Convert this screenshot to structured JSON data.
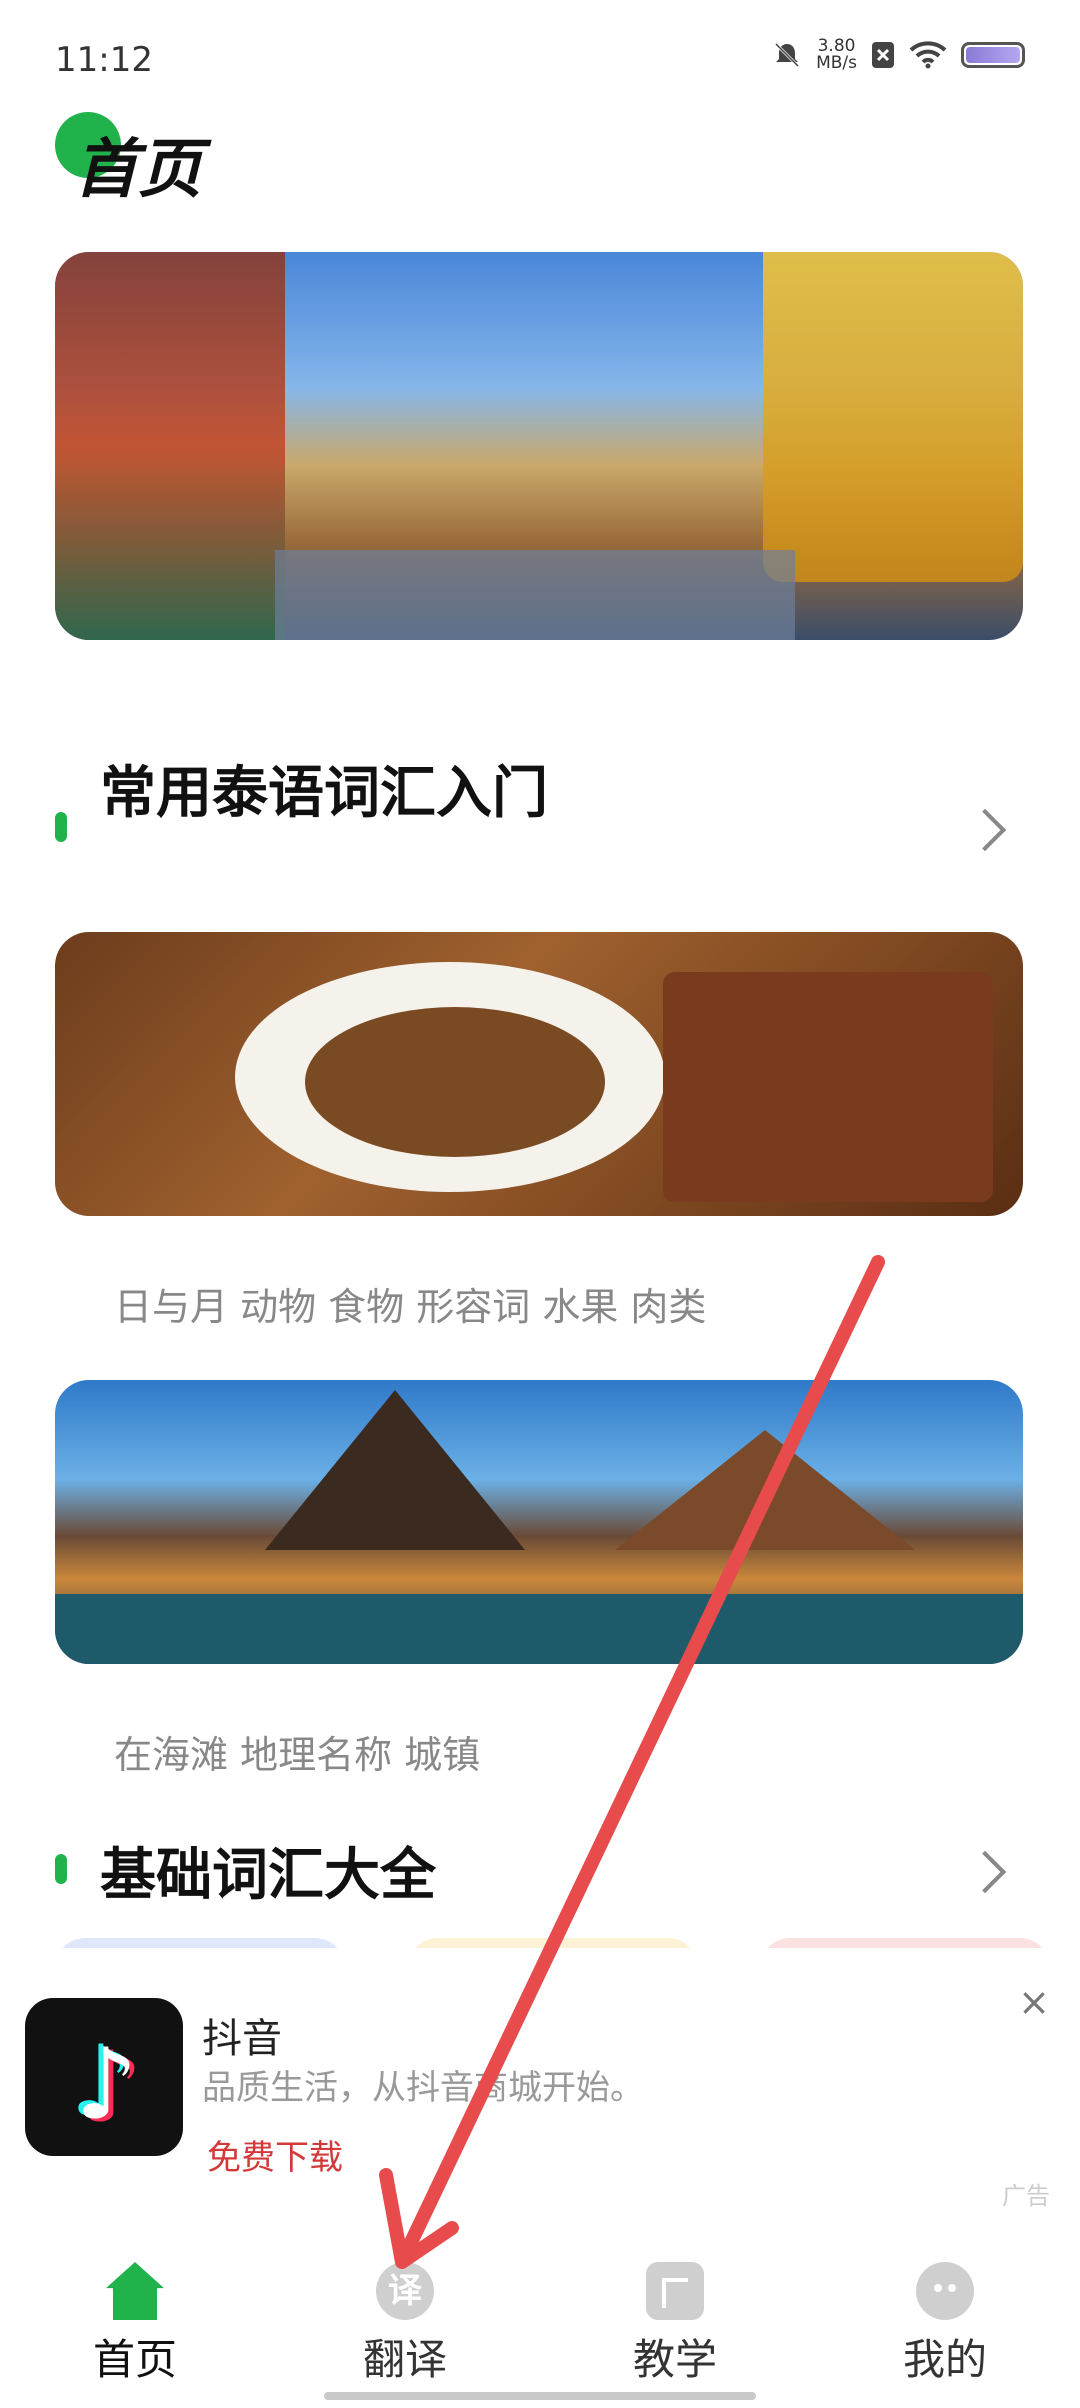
{
  "status_bar": {
    "time": "11:12",
    "speed_value": "3.80",
    "speed_unit": "MB/s"
  },
  "header": {
    "title": "首页"
  },
  "section1": {
    "title": "常用泰语词汇入门",
    "tags_food": "日与月 动物 食物 形容词 水果 肉类",
    "tags_place": "在海滩 地理名称 城镇"
  },
  "section2": {
    "title": "基础词汇大全"
  },
  "ad": {
    "app_name": "抖音",
    "description": "品质生活，从抖音商城开始。",
    "cta": "免费下载",
    "label": "广告",
    "close": "×"
  },
  "tabs": [
    {
      "label": "首页",
      "icon": "home-icon",
      "active": true
    },
    {
      "label": "翻译",
      "icon": "translate-icon",
      "glyph": "译"
    },
    {
      "label": "教学",
      "icon": "teach-icon"
    },
    {
      "label": "我的",
      "icon": "profile-icon"
    }
  ],
  "colors": {
    "accent": "#22b24c",
    "arrow": "#e84b4b",
    "cta": "#d23a3a"
  }
}
